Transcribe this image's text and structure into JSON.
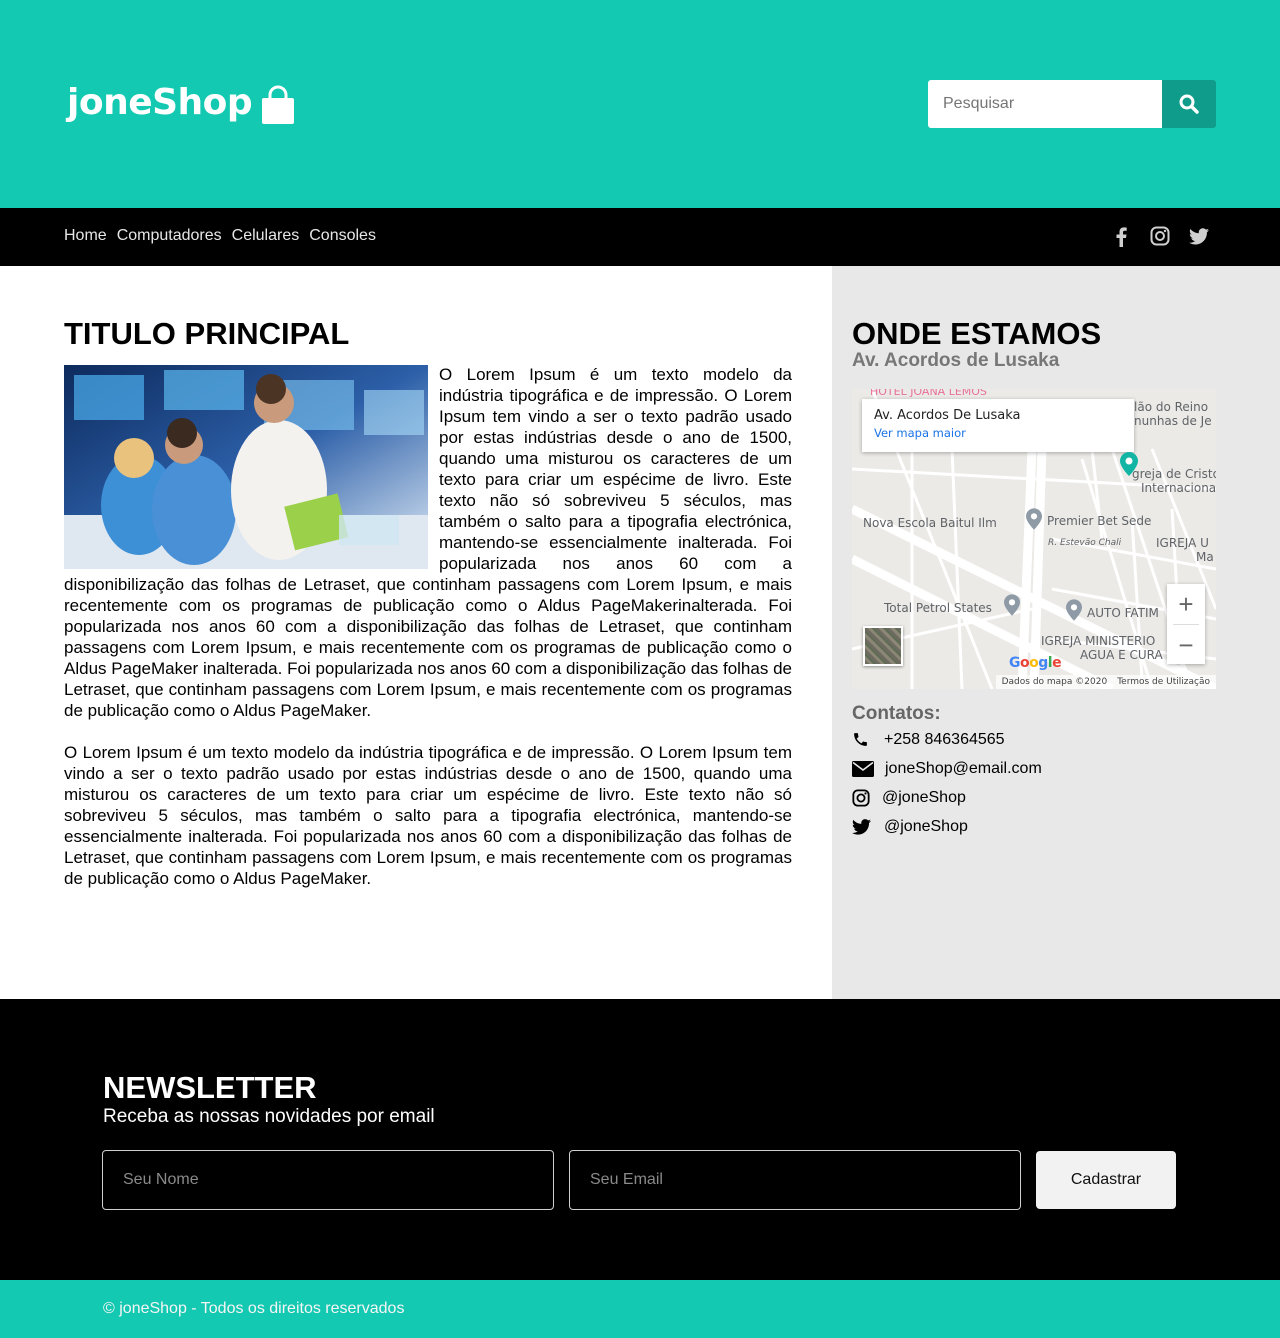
{
  "header": {
    "logo_text": "joneShop",
    "search_placeholder": "Pesquisar"
  },
  "nav": {
    "links": [
      "Home",
      "Computadores",
      "Celulares",
      "Consoles"
    ]
  },
  "main": {
    "title": "TITULO PRINCIPAL",
    "paragraph1": "O Lorem Ipsum é um texto modelo da indústria tipográfica e de impressão. O Lorem Ipsum tem vindo a ser o texto padrão usado por estas indústrias desde o ano de 1500, quando uma misturou os caracteres de um texto para criar um espécime de livro. Este texto não só sobreviveu 5 séculos, mas também o salto para a tipografia electrónica, mantendo-se essencialmente inalterada. Foi popularizada nos anos 60 com a disponibilização das folhas de Letraset, que continham passagens com Lorem Ipsum, e mais recentemente com os programas de publicação como o Aldus PageMakerinalterada. Foi popularizada nos anos 60 com a disponibilização das folhas de Letraset, que continham passagens com Lorem Ipsum, e mais recentemente com os programas de publicação como o Aldus PageMaker inalterada. Foi popularizada nos anos 60 com a disponibilização das folhas de Letraset, que continham passagens com Lorem Ipsum, e mais recentemente com os programas de publicação como o Aldus PageMaker.",
    "paragraph2": "O Lorem Ipsum é um texto modelo da indústria tipográfica e de impressão. O Lorem Ipsum tem vindo a ser o texto padrão usado por estas indústrias desde o ano de 1500, quando uma misturou os caracteres de um texto para criar um espécime de livro. Este texto não só sobreviveu 5 séculos, mas também o salto para a tipografia electrónica, mantendo-se essencialmente inalterada. Foi popularizada nos anos 60 com a disponibilização das folhas de Letraset, que continham passagens com Lorem Ipsum, e mais recentemente com os programas de publicação como o Aldus PageMaker."
  },
  "sidebar": {
    "title": "ONDE ESTAMOS",
    "address": "Av. Acordos de Lusaka",
    "map": {
      "card_title": "Av. Acordos De Lusaka",
      "card_link": "Ver mapa maior",
      "labels": [
        "HOTEL JOANA LEMOS",
        "lão do Reino",
        "nunhas de Je",
        "greja de Cristo",
        "Internaciona",
        "Nova Escola Baitul Ilm",
        "Premier Bet Sede",
        "R. Estevão Chali",
        "IGREJA U",
        "Ma",
        "Total Petrol States",
        "AUTO FATIM",
        "IGREJA MINISTERIO",
        "AGUA E CURA"
      ],
      "zoom_in": "+",
      "zoom_out": "−",
      "google": "Google",
      "attribution": "Dados do mapa ©2020",
      "terms": "Termos de Utilização"
    },
    "contacts_title": "Contatos:",
    "phone": "+258 846364565",
    "email": "joneShop@email.com",
    "instagram": "@joneShop",
    "twitter": "@joneShop"
  },
  "newsletter": {
    "title": "NEWSLETTER",
    "subtitle": "Receba as nossas novidades por email",
    "name_placeholder": "Seu Nome",
    "email_placeholder": "Seu Email",
    "submit_label": "Cadastrar"
  },
  "footer": {
    "text": "© joneShop - Todos os direitos reservados"
  },
  "colors": {
    "brand": "#14c9b1",
    "brand_dark": "#0f9c8a",
    "nav_bg": "#000000",
    "sidebar_bg": "#e8e8e8"
  },
  "icons": [
    "shopping-bag-icon",
    "search-icon",
    "facebook-icon",
    "instagram-icon",
    "twitter-icon",
    "phone-icon",
    "envelope-icon",
    "map-pin-icon"
  ]
}
